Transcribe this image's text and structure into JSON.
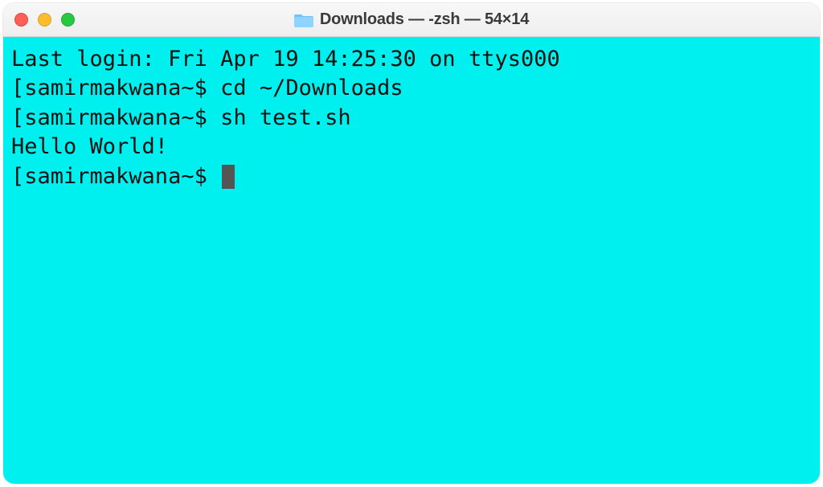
{
  "window_title": "Downloads — -zsh — 54×14",
  "colors": {
    "terminal_bg": "#00f0f0",
    "text": "#111111",
    "close": "#ff5f57",
    "minimize": "#febc2e",
    "maximize": "#28c840"
  },
  "terminal": {
    "last_login": "Last login: Fri Apr 19 14:25:30 on ttys000",
    "prompt_user": "samirmakwana",
    "lines": [
      {
        "prompt": "[samirmakwana~$ ",
        "cmd": "cd ~/Downloads"
      },
      {
        "prompt": "[samirmakwana~$ ",
        "cmd": "sh test.sh"
      },
      {
        "output": "Hello World!"
      },
      {
        "prompt": "[samirmakwana~$ ",
        "cmd": "",
        "cursor": true
      }
    ]
  }
}
